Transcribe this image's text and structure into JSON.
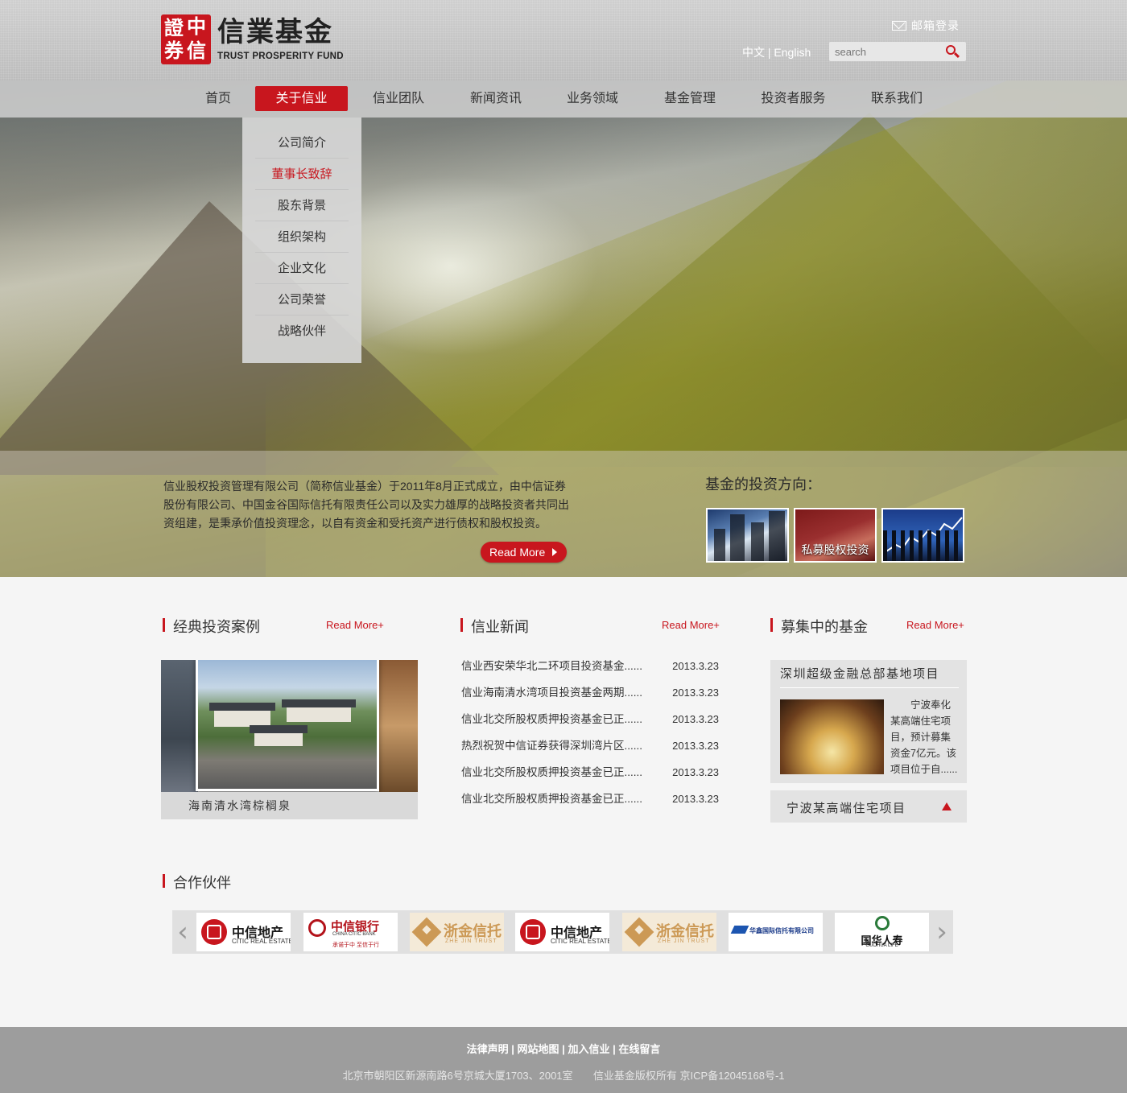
{
  "header": {
    "logo_title": "信業基金",
    "logo_subtitle": "TRUST PROSPERITY FUND",
    "seal_chars": [
      "證",
      "中",
      "券",
      "信"
    ],
    "mail_login": "邮箱登录",
    "lang_cn": "中文",
    "lang_sep": "|",
    "lang_en": "English",
    "search_placeholder": "search"
  },
  "nav": {
    "items": [
      {
        "label": "首页"
      },
      {
        "label": "关于信业",
        "active": true
      },
      {
        "label": "信业团队"
      },
      {
        "label": "新闻资讯"
      },
      {
        "label": "业务领域"
      },
      {
        "label": "基金管理"
      },
      {
        "label": "投资者服务"
      },
      {
        "label": "联系我们"
      }
    ],
    "dropdown": [
      {
        "label": "公司简介"
      },
      {
        "label": "董事长致辞",
        "active": true
      },
      {
        "label": "股东背景"
      },
      {
        "label": "组织架构"
      },
      {
        "label": "企业文化"
      },
      {
        "label": "公司荣誉"
      },
      {
        "label": "战略伙伴"
      }
    ]
  },
  "hero": {
    "intro": "信业股权投资管理有限公司（简称信业基金）于2011年8月正式成立，由中信证券股份有限公司、中国金谷国际信托有限责任公司以及实力雄厚的战略投资者共同出资组建，是秉承价值投资理念，以自有资金和受托资产进行债权和股权投资。",
    "read_more": "Read More",
    "invest_title": "基金的投资方向：",
    "thumb_caption": "私募股权投资"
  },
  "cases": {
    "title": "经典投资案例",
    "more": "Read More+",
    "caption": "海南清水湾棕榈泉"
  },
  "news": {
    "title": "信业新闻",
    "more": "Read More+",
    "items": [
      {
        "title": "信业西安荣华北二环项目投资基金......",
        "date": "2013.3.23"
      },
      {
        "title": "信业海南清水湾项目投资基金两期......",
        "date": "2013.3.23"
      },
      {
        "title": "信业北交所股权质押投资基金已正......",
        "date": "2013.3.23"
      },
      {
        "title": "热烈祝贺中信证券获得深圳湾片区......",
        "date": "2013.3.23"
      },
      {
        "title": "信业北交所股权质押投资基金已正......",
        "date": "2013.3.23"
      },
      {
        "title": "信业北交所股权质押投资基金已正......",
        "date": "2013.3.23"
      }
    ]
  },
  "funds": {
    "title": "募集中的基金",
    "more": "Read More+",
    "featured_title": "深圳超级金融总部基地项目",
    "featured_desc": "宁波奉化某高端住宅项目，预计募集资金7亿元。该项目位于自......",
    "second_title": "宁波某高端住宅项目"
  },
  "partners": {
    "title": "合作伙伴",
    "prev": "‹",
    "next": "›",
    "logos": [
      {
        "name": "中信地产",
        "sub": "CITIC REAL ESTATE"
      },
      {
        "name": "中信银行",
        "sub": "CHINA CITIC BANK",
        "slogan": "承诺于中 至信于行"
      },
      {
        "name": "浙金信托",
        "sub": "ZHE JIN TRUST"
      },
      {
        "name": "中信地产",
        "sub": "CITIC REAL ESTATE"
      },
      {
        "name": "浙金信托",
        "sub": "ZHE JIN TRUST"
      },
      {
        "name": "华鑫国际信托有限公司"
      },
      {
        "name": "国华人寿",
        "sub": "GUOHUA LIFE"
      }
    ]
  },
  "footer": {
    "links": [
      "法律声明",
      "网站地图",
      "加入信业",
      "在线留言"
    ],
    "sep": "|",
    "address": "北京市朝阳区新源南路6号京城大厦1703、2001室",
    "copyright": "信业基金版权所有 京ICP备12045168号-1"
  },
  "colors": {
    "brand_red": "#c8161e",
    "nav_bg": "#cdcdcd",
    "footer_bg": "#9d9d9d"
  }
}
